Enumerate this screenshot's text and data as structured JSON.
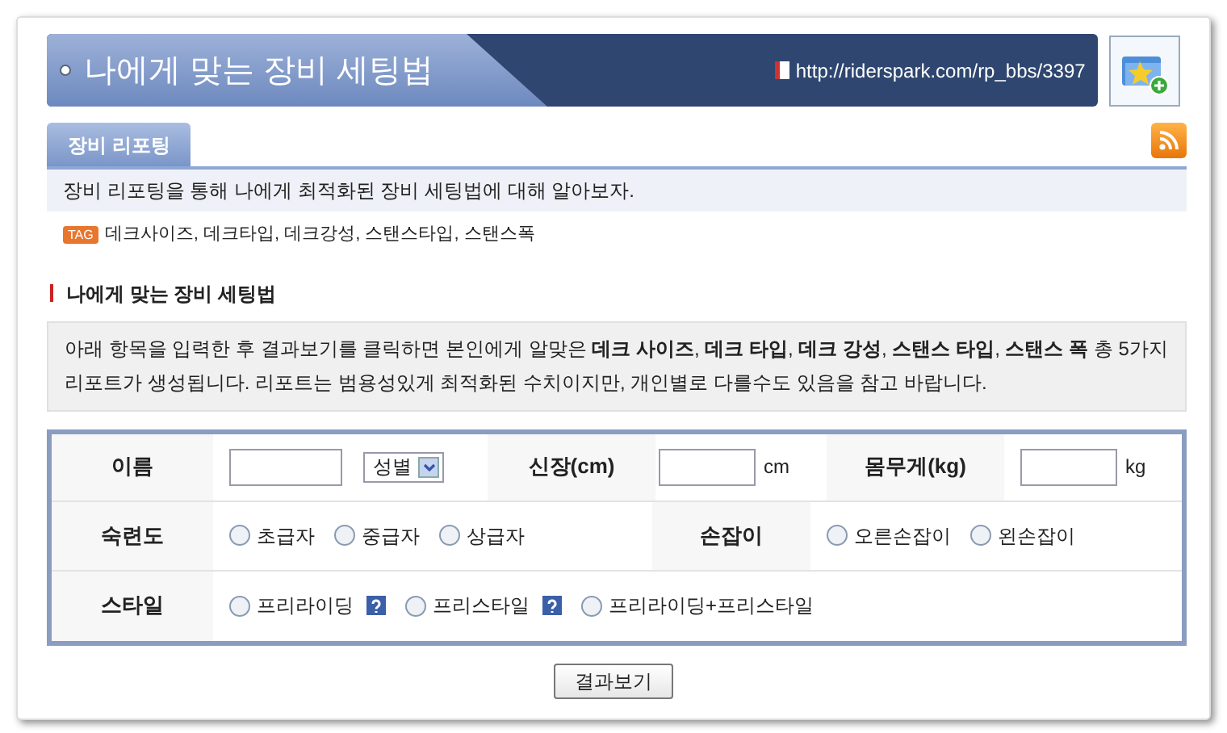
{
  "header": {
    "title": "나에게 맞는 장비 세팅법",
    "url": "http://riderspark.com/rp_bbs/3397"
  },
  "tabs": [
    {
      "label": "장비 리포팅",
      "selected": true
    }
  ],
  "intro": "장비 리포팅을 통해 나에게 최적화된 장비 세팅법에 대해 알아보자.",
  "tags": {
    "badge": "TAG",
    "text": "데크사이즈, 데크타입, 데크강성, 스탠스타입, 스탠스폭"
  },
  "section": {
    "heading": "나에게 맞는 장비 세팅법",
    "description": "아래 항목을 입력한 후 결과보기를 클릭하면 본인에게 알맞은 **데크 사이즈**, **데크 타입**, **데크 강성**, **스탠스 타입**, **스탠스 폭** 총 5가지 리포트가 생성됩니다. 리포트는 범용성있게 최적화된 수치이지만, 개인별로 다를수도 있음을 참고 바랍니다."
  },
  "form": {
    "name_label": "이름",
    "gender_select": "성별",
    "height_label": "신장(cm)",
    "height_unit": "cm",
    "weight_label": "몸무게(kg)",
    "weight_unit": "kg",
    "skill_label": "숙련도",
    "skill_options": [
      {
        "label": "초급자",
        "selected": false
      },
      {
        "label": "중급자",
        "selected": false
      },
      {
        "label": "상급자",
        "selected": false
      }
    ],
    "hand_label": "손잡이",
    "hand_options": [
      {
        "label": "오른손잡이",
        "selected": false
      },
      {
        "label": "왼손잡이",
        "selected": false
      }
    ],
    "style_label": "스타일",
    "style_options": [
      {
        "label": "프리라이딩",
        "selected": false,
        "help": true
      },
      {
        "label": "프리스타일",
        "selected": false,
        "help": true
      },
      {
        "label": "프리라이딩+프리스타일",
        "selected": false,
        "help": false
      }
    ]
  },
  "submit": "결과보기"
}
